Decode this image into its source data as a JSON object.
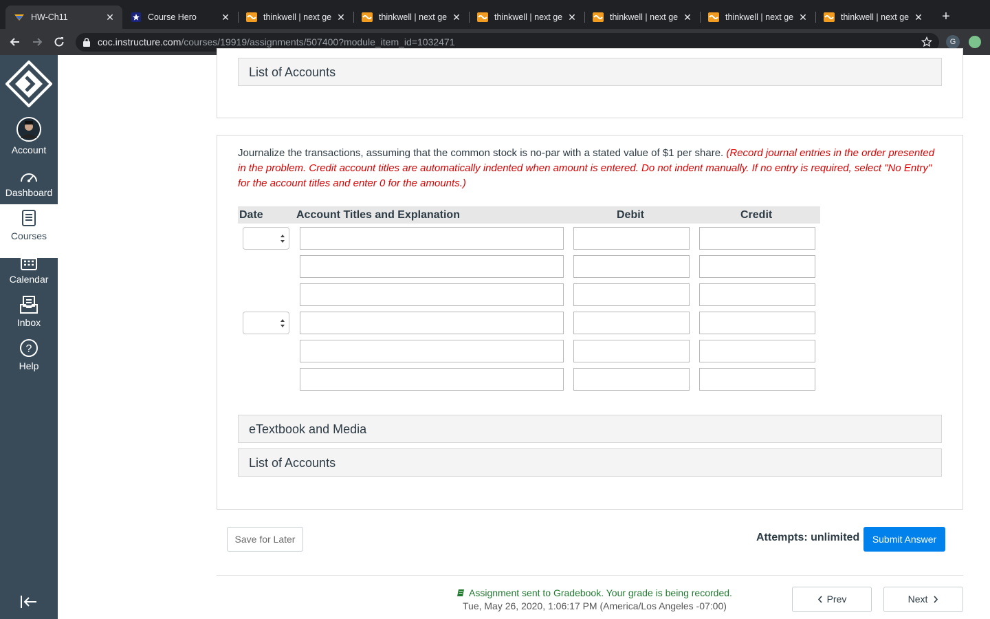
{
  "browser": {
    "tabs": [
      {
        "title": "HW-Ch11",
        "icon": "canvas-icon",
        "active": true
      },
      {
        "title": "Course Hero",
        "icon": "coursehero-icon",
        "active": false
      },
      {
        "title": "thinkwell | next ge",
        "icon": "thinkwell-icon",
        "active": false
      },
      {
        "title": "thinkwell | next ge",
        "icon": "thinkwell-icon",
        "active": false
      },
      {
        "title": "thinkwell | next ge",
        "icon": "thinkwell-icon",
        "active": false
      },
      {
        "title": "thinkwell | next ge",
        "icon": "thinkwell-icon",
        "active": false
      },
      {
        "title": "thinkwell | next ge",
        "icon": "thinkwell-icon",
        "active": false
      },
      {
        "title": "thinkwell | next ge",
        "icon": "thinkwell-icon",
        "active": false
      }
    ],
    "url_host": "coc.instructure.com",
    "url_path": "/courses/19919/assignments/507400?module_item_id=1032471",
    "profile_initial": "G"
  },
  "sidebar": {
    "items": [
      {
        "label": "Account",
        "icon": "avatar-icon"
      },
      {
        "label": "Dashboard",
        "icon": "dashboard-icon"
      },
      {
        "label": "Courses",
        "icon": "courses-icon"
      },
      {
        "label": "Calendar",
        "icon": "calendar-icon"
      },
      {
        "label": "Inbox",
        "icon": "inbox-icon"
      },
      {
        "label": "Help",
        "icon": "help-icon"
      }
    ],
    "active": "Courses"
  },
  "accordions": {
    "top": "List of Accounts",
    "etextbook": "eTextbook and Media",
    "bottom": "List of Accounts"
  },
  "question": {
    "instruction": "Journalize the transactions, assuming that the common stock is no-par with a stated value of $1 per share.",
    "note": "(Record journal entries in the order presented in the problem. Credit account titles are automatically indented when amount is entered. Do not indent manually. If no entry is required, select \"No Entry\" for the account titles and enter 0 for the amounts.)"
  },
  "table": {
    "headers": {
      "date": "Date",
      "account": "Account Titles and Explanation",
      "debit": "Debit",
      "credit": "Credit"
    },
    "rows": [
      {
        "date": "",
        "account": "",
        "debit": "",
        "credit": ""
      },
      {
        "date": null,
        "account": "",
        "debit": "",
        "credit": ""
      },
      {
        "date": null,
        "account": "",
        "debit": "",
        "credit": ""
      },
      {
        "date": "",
        "account": "",
        "debit": "",
        "credit": ""
      },
      {
        "date": null,
        "account": "",
        "debit": "",
        "credit": ""
      },
      {
        "date": null,
        "account": "",
        "debit": "",
        "credit": ""
      }
    ]
  },
  "actions": {
    "save_later": "Save for Later",
    "attempts": "Attempts: unlimited",
    "submit": "Submit Answer"
  },
  "footer": {
    "grade_message": "Assignment sent to Gradebook. Your grade is being recorded.",
    "timestamp": "Tue, May 26, 2020, 1:06:17 PM (America/Los Angeles -07:00)",
    "prev": "Prev",
    "next": "Next"
  },
  "colors": {
    "sidebar": "#394b58",
    "accent": "#0081ec",
    "instruction_note": "#e00000",
    "success": "#1f7a2f"
  }
}
